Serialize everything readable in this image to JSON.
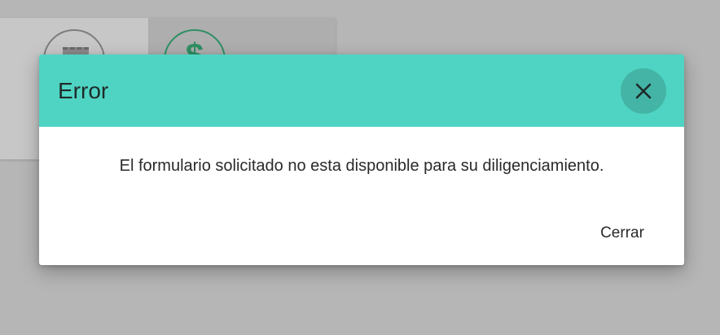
{
  "background": {
    "icons": [
      "calendar-icon",
      "money-icon",
      "upload-icon"
    ],
    "money_glyph": "$",
    "colors": {
      "overlay": "#b6b6b6",
      "money_icon": "#2e8f63",
      "upload_icon": "#2a8fa0"
    }
  },
  "dialog": {
    "title": "Error",
    "message": "El formulario solicitado no esta disponible para su diligenciamiento.",
    "close_icon": "close-icon",
    "action_label": "Cerrar",
    "colors": {
      "header": "#4fd4c3",
      "close_button": "#43b4a5",
      "body": "#ffffff"
    }
  }
}
